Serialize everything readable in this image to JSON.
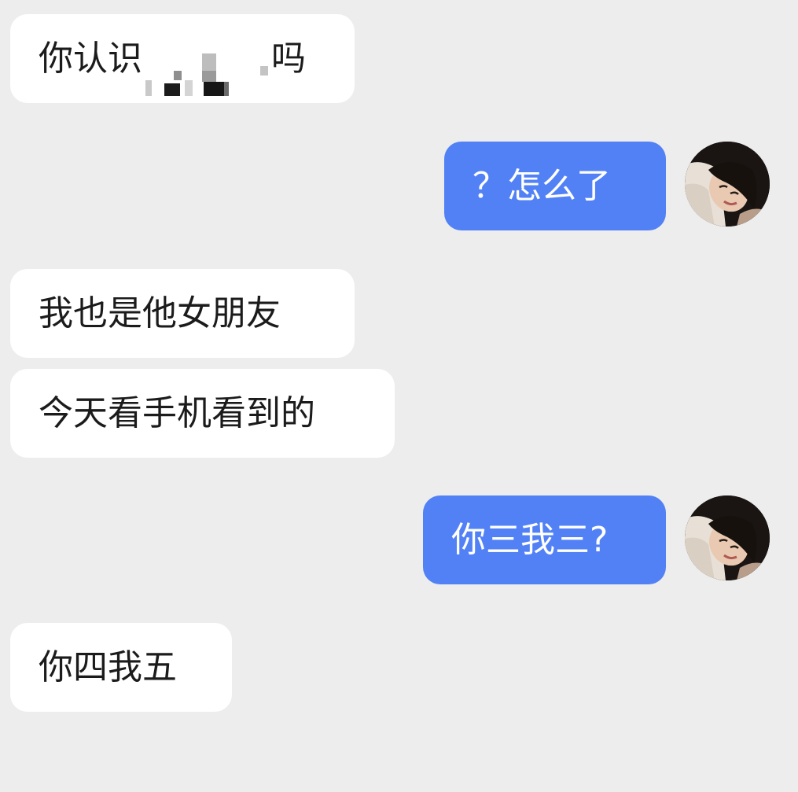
{
  "messages": [
    {
      "side": "incoming",
      "prefix": "你认识",
      "suffix": "吗",
      "redacted": true
    },
    {
      "side": "outgoing",
      "text": "？怎么了"
    },
    {
      "side": "incoming",
      "text": "我也是他女朋友"
    },
    {
      "side": "incoming",
      "text": "今天看手机看到的"
    },
    {
      "side": "outgoing",
      "text": "你三我三?"
    },
    {
      "side": "incoming",
      "text": "你四我五"
    }
  ],
  "colors": {
    "background": "#ededed",
    "incoming_bubble": "#ffffff",
    "outgoing_bubble": "#5281f6",
    "incoming_text": "#1b1b1b",
    "outgoing_text": "#ffffff"
  },
  "icons": {
    "avatar": "user-avatar-photo",
    "redaction": "mosaic-redaction"
  }
}
